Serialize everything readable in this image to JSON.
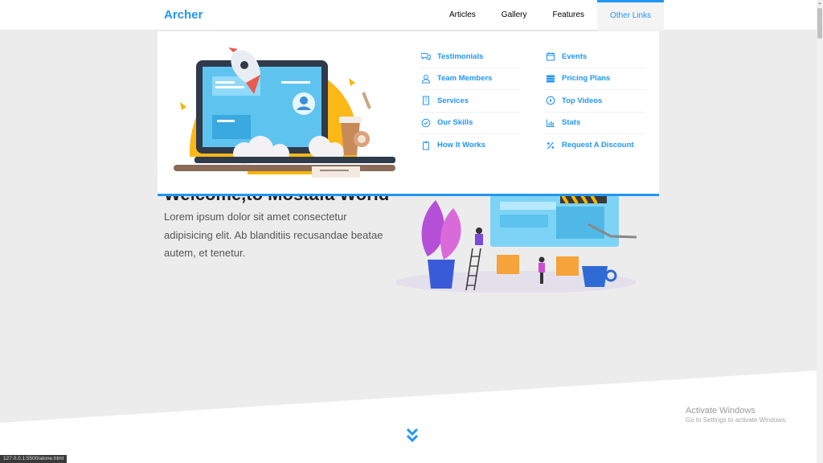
{
  "header": {
    "logo": "Archer",
    "nav": [
      {
        "label": "Articles"
      },
      {
        "label": "Gallery"
      },
      {
        "label": "Features"
      },
      {
        "label": "Other Links"
      }
    ]
  },
  "mega_menu": {
    "column1": [
      {
        "label": "Testimonials",
        "icon": "comments-icon"
      },
      {
        "label": "Team Members",
        "icon": "user-icon"
      },
      {
        "label": "Services",
        "icon": "building-icon"
      },
      {
        "label": "Our Skills",
        "icon": "check-circle-icon"
      },
      {
        "label": "How It Works",
        "icon": "clipboard-icon"
      }
    ],
    "column2": [
      {
        "label": "Events",
        "icon": "calendar-icon"
      },
      {
        "label": "Pricing Plans",
        "icon": "server-icon"
      },
      {
        "label": "Top Videos",
        "icon": "play-circle-icon"
      },
      {
        "label": "Stats",
        "icon": "bar-chart-icon"
      },
      {
        "label": "Request A Discount",
        "icon": "percent-icon"
      }
    ]
  },
  "landing": {
    "title": "Welcome,to Mostafa World",
    "text": "Lorem ipsum dolor sit amet consectetur adipisicing elit. Ab blanditiis recusandae beatae autem, et tenetur."
  },
  "watermark": {
    "title": "Activate Windows",
    "subtitle": "Go to Settings to activate Windows."
  },
  "status_bar": {
    "url": "127.0.0.1:5500/alone.html"
  },
  "colors": {
    "accent": "#2196f3",
    "background": "#ececec",
    "menu_bg": "#ffffff"
  }
}
